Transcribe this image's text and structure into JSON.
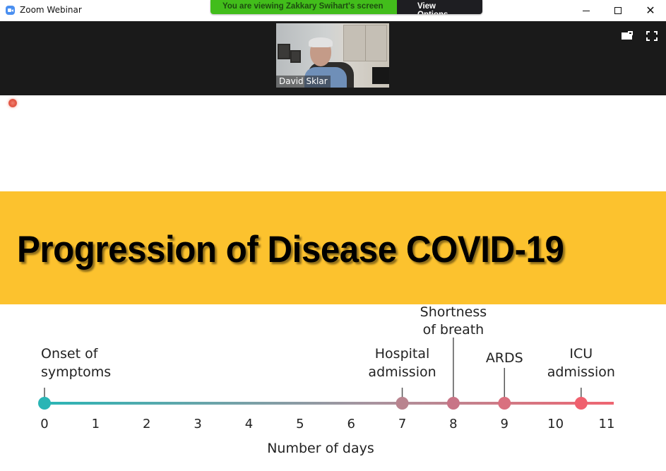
{
  "window": {
    "app_title": "Zoom Webinar",
    "app_icon": "zoom-camera-icon",
    "controls": [
      "minimize-icon",
      "maximize-icon",
      "close-icon"
    ]
  },
  "share_banner": {
    "message": "You are viewing Zakkary Swihart's screen",
    "view_options_label": "View Options",
    "view_options_icon": "chevron-down-icon",
    "colors": {
      "message_bg": "#42bd1b",
      "options_bg": "#1e1e22"
    }
  },
  "video_strip": {
    "participant_name": "David Sklar",
    "icons": [
      "layout-icon",
      "fullscreen-icon"
    ]
  },
  "shared_screen": {
    "recording_indicator": "recording-dot-icon",
    "slide_title": "Progression of Disease COVID-19",
    "title_band_color": "#fcc22e"
  },
  "chart_data": {
    "type": "timeline",
    "title": "Progression of Disease COVID-19",
    "xlabel": "Number of days",
    "ylabel": "",
    "xlim": [
      0,
      11
    ],
    "ticks": [
      "0",
      "1",
      "2",
      "3",
      "4",
      "5",
      "6",
      "7",
      "8",
      "9",
      "10",
      "11"
    ],
    "grid": false,
    "events": [
      {
        "label_lines": [
          "Onset of",
          "symptoms"
        ],
        "day": 0,
        "color": "#2ab5b5",
        "level": "low"
      },
      {
        "label_lines": [
          "Hospital",
          "admission"
        ],
        "day": 7,
        "color": "#b9848f",
        "level": "low"
      },
      {
        "label_lines": [
          "Shortness",
          "of breath"
        ],
        "day": 8,
        "color": "#c87486",
        "level": "high"
      },
      {
        "label_lines": [
          "ARDS"
        ],
        "day": 9,
        "color": "#d9707f",
        "level": "mid"
      },
      {
        "label_lines": [
          "ICU",
          "admission"
        ],
        "day": 10.5,
        "color": "#f0606e",
        "level": "low"
      }
    ],
    "line_gradient": [
      "#2ab5b5",
      "#a9939e",
      "#ef6571"
    ]
  }
}
